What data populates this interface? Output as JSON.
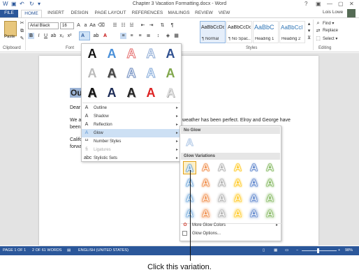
{
  "window": {
    "title": "Chapter 3 Vacation Formatting.docx - Word",
    "controls": [
      "?",
      "▣",
      "—",
      "▢",
      "✕"
    ]
  },
  "tabs": [
    "FILE",
    "HOME",
    "INSERT",
    "DESIGN",
    "PAGE LAYOUT",
    "REFERENCES",
    "MAILINGS",
    "REVIEW",
    "VIEW"
  ],
  "user": {
    "name": "Lois Lowe"
  },
  "ribbon": {
    "clipboard_label": "Clipboard",
    "paste_label": "Paste",
    "font_label": "Font",
    "font_name": "Arial Black",
    "font_size": "16",
    "styles_label": "Styles",
    "editing_label": "Editing",
    "styles": [
      {
        "sample": "AaBbCcDc",
        "name": "¶ Normal"
      },
      {
        "sample": "AaBbCcDc",
        "name": "¶ No Spac..."
      },
      {
        "sample": "AaBbC",
        "name": "Heading 1"
      },
      {
        "sample": "AaBbCcl",
        "name": "Heading 2"
      }
    ],
    "editing": {
      "find": "Find ▾",
      "replace": "Replace",
      "select": "Select ▾"
    }
  },
  "document": {
    "heading_fragment": "Ou",
    "lines": [
      "Dear",
      "We ar",
      "been",
      "Califo",
      "forwa"
    ],
    "tail_line": "weather has been perfect. Elroy and George have"
  },
  "text_effects_menu": {
    "effect_letter": "A",
    "items": [
      {
        "label": "Outline",
        "icon": "outline-icon",
        "has_submenu": true
      },
      {
        "label": "Shadow",
        "icon": "shadow-icon",
        "has_submenu": true
      },
      {
        "label": "Reflection",
        "icon": "reflection-icon",
        "has_submenu": true
      },
      {
        "label": "Glow",
        "icon": "glow-icon",
        "has_submenu": true
      },
      {
        "label": "Number Styles",
        "icon": "number-styles-icon",
        "has_submenu": true
      },
      {
        "label": "Ligatures",
        "icon": "ligatures-icon",
        "has_submenu": true
      },
      {
        "label": "Stylistic Sets",
        "icon": "stylistic-sets-icon",
        "has_submenu": true
      }
    ]
  },
  "glow_submenu": {
    "no_glow_label": "No Glow",
    "variations_label": "Glow Variations",
    "glow_colors": [
      "#5b9bd5",
      "#ed7d31",
      "#a5a5a5",
      "#ffc000",
      "#4472c4",
      "#70ad47"
    ],
    "more_colors": "More Glow Colors",
    "options": "Glow Options..."
  },
  "status_bar": {
    "page": "PAGE 1 OF 1",
    "words": "2 OF 61 WORDS",
    "language": "ENGLISH (UNITED STATES)",
    "zoom": "98%"
  },
  "caption": "Click this variation."
}
